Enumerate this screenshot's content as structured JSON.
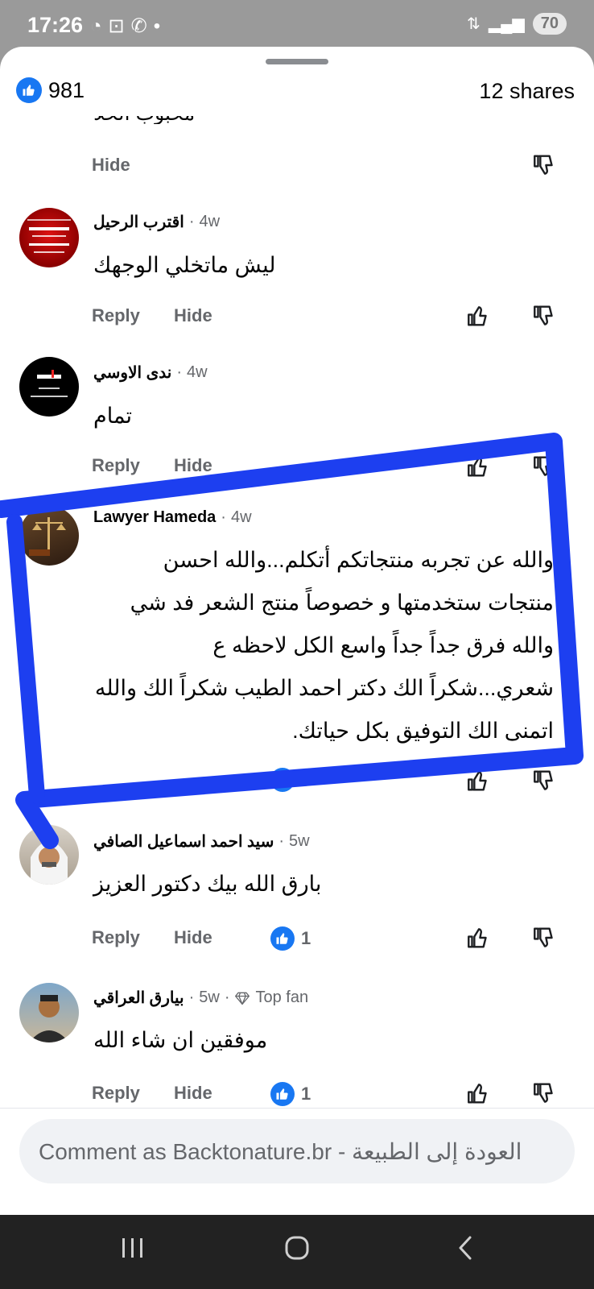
{
  "status": {
    "time": "17:26",
    "left_icons": [
      "whatsapp-status-icon",
      "screenshot-icon",
      "whatsapp-icon",
      "dot-icon"
    ],
    "battery": "70"
  },
  "summary": {
    "likes": "981",
    "shares": "12 shares"
  },
  "actions": {
    "reply": "Reply",
    "hide": "Hide"
  },
  "cut_comment": {
    "text_fragment": "محبوب الحلا"
  },
  "comments": [
    {
      "author": "اقترب الرحيل",
      "time": "4w",
      "text": "ليش ماتخلي الوجهك"
    },
    {
      "author": "ندى الاوسي",
      "time": "4w",
      "text": "تمام"
    },
    {
      "author": "Lawyer Hameda",
      "time": "4w",
      "text": "والله عن تجربه منتجاتكم أتكلم...والله احسن منتجات ستخدمتها و خصوصاً منتج الشعر فد شي والله فرق جداً جداً واسع الكل لاحظه ع شعري...شكراً الك دكتر احمد الطيب شكراً الك والله اتمنى الك التوفيق بكل حياتك.",
      "reactions": "1"
    },
    {
      "author": "سيد احمد اسماعيل الصافي",
      "time": "5w",
      "text": "بارق الله بيك دكتور العزيز",
      "reactions": "1"
    },
    {
      "author": "بيارق العراقي",
      "time": "5w",
      "badge": "Top fan",
      "text": "موفقين ان شاء الله",
      "reactions": "1"
    }
  ],
  "composer": {
    "placeholder": "Comment as Backtonature.br - العودة إلى الطبيعة"
  },
  "colors": {
    "facebook_blue": "#1877f2",
    "annotation_blue": "#1d3ff0",
    "secondary_text": "#65676b"
  }
}
